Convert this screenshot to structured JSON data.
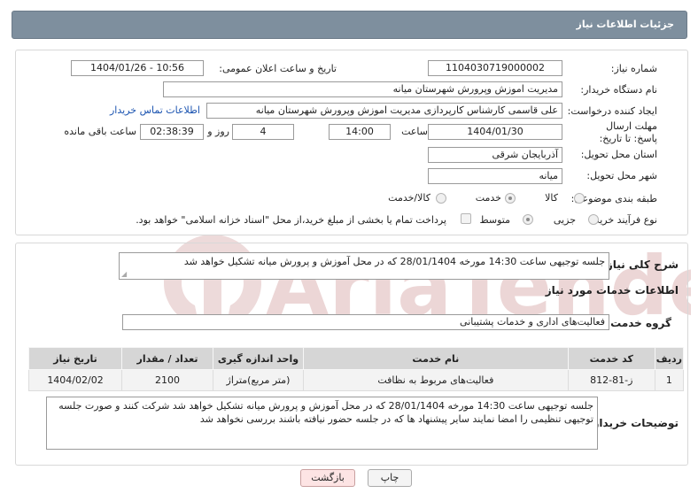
{
  "header": {
    "title": "جزئیات اطلاعات نیاز"
  },
  "form": {
    "need_number_label": "شماره نیاز:",
    "need_number": "1104030719000002",
    "announce_label": "تاریخ و ساعت اعلان عمومی:",
    "announce_value": "1404/01/26 - 10:56",
    "buyer_org_label": "نام دستگاه خریدار:",
    "buyer_org": "مدیریت اموزش وپرورش شهرستان میانه",
    "creator_label": "ایجاد کننده درخواست:",
    "creator": "علی قاسمی کارشناس کارپردازی مدیریت اموزش وپرورش شهرستان میانه",
    "contact_link": "اطلاعات تماس خریدار",
    "deadline_label": "مهلت ارسال پاسخ: تا تاریخ:",
    "deadline_date": "1404/01/30",
    "time_label": "ساعت",
    "deadline_time": "14:00",
    "days_value": "4",
    "days_label": "روز و",
    "remaining_time": "02:38:39",
    "remaining_label": "ساعت باقی مانده",
    "province_label": "استان محل تحویل:",
    "province": "آذربایجان شرقی",
    "city_label": "شهر محل تحویل:",
    "city": "میانه",
    "category_label": "طبقه بندی موضوعی:",
    "category_options": [
      "کالا",
      "خدمت",
      "کالا/خدمت"
    ],
    "category_selected": 1,
    "process_label": "نوع فرآیند خرید :",
    "process_options": [
      "جزیی",
      "متوسط"
    ],
    "process_selected": 0,
    "payment_note": "پرداخت تمام یا بخشی از مبلغ خرید،از محل \"اسناد خزانه اسلامی\" خواهد بود."
  },
  "summary": {
    "label": "شرح کلی نیاز:",
    "text": "جلسه توجیهی ساعت 14:30 مورخه 28/01/1404 که در محل آموزش و پرورش میانه تشکیل خواهد شد"
  },
  "services": {
    "section_title": "اطلاعات خدمات مورد نیاز",
    "group_label": "گروه خدمت:",
    "group_value": "فعالیت‌های اداری و خدمات پشتیبانی",
    "columns": [
      "ردیف",
      "کد خدمت",
      "نام خدمت",
      "واحد اندازه گیری",
      "تعداد / مقدار",
      "تاریخ نیاز"
    ],
    "rows": [
      [
        "1",
        "ز-81-812",
        "فعالیت‌های مربوط به نظافت",
        "(متر مربع)متراژ",
        "2100",
        "1404/02/02"
      ]
    ]
  },
  "buyer_notes": {
    "label": "توضیحات خریدار:",
    "text": "جلسه توجیهی ساعت 14:30 مورخه 28/01/1404 که در محل آموزش و پرورش میانه تشکیل خواهد شد شرکت کنند و صورت جلسه توجیهی تنظیمی را امضا نمایند سایر پیشنهاد ها که در جلسه حضور نیافته باشند بررسی نخواهد شد"
  },
  "buttons": {
    "print": "چاپ",
    "back": "بازگشت"
  },
  "watermark": {
    "text": "AriaTender.net",
    "color": "#e8d2d2"
  },
  "colors": {
    "header_bg": "#7e8f9e",
    "link": "#1a53b0",
    "back_button_bg": "#fde4e4"
  }
}
